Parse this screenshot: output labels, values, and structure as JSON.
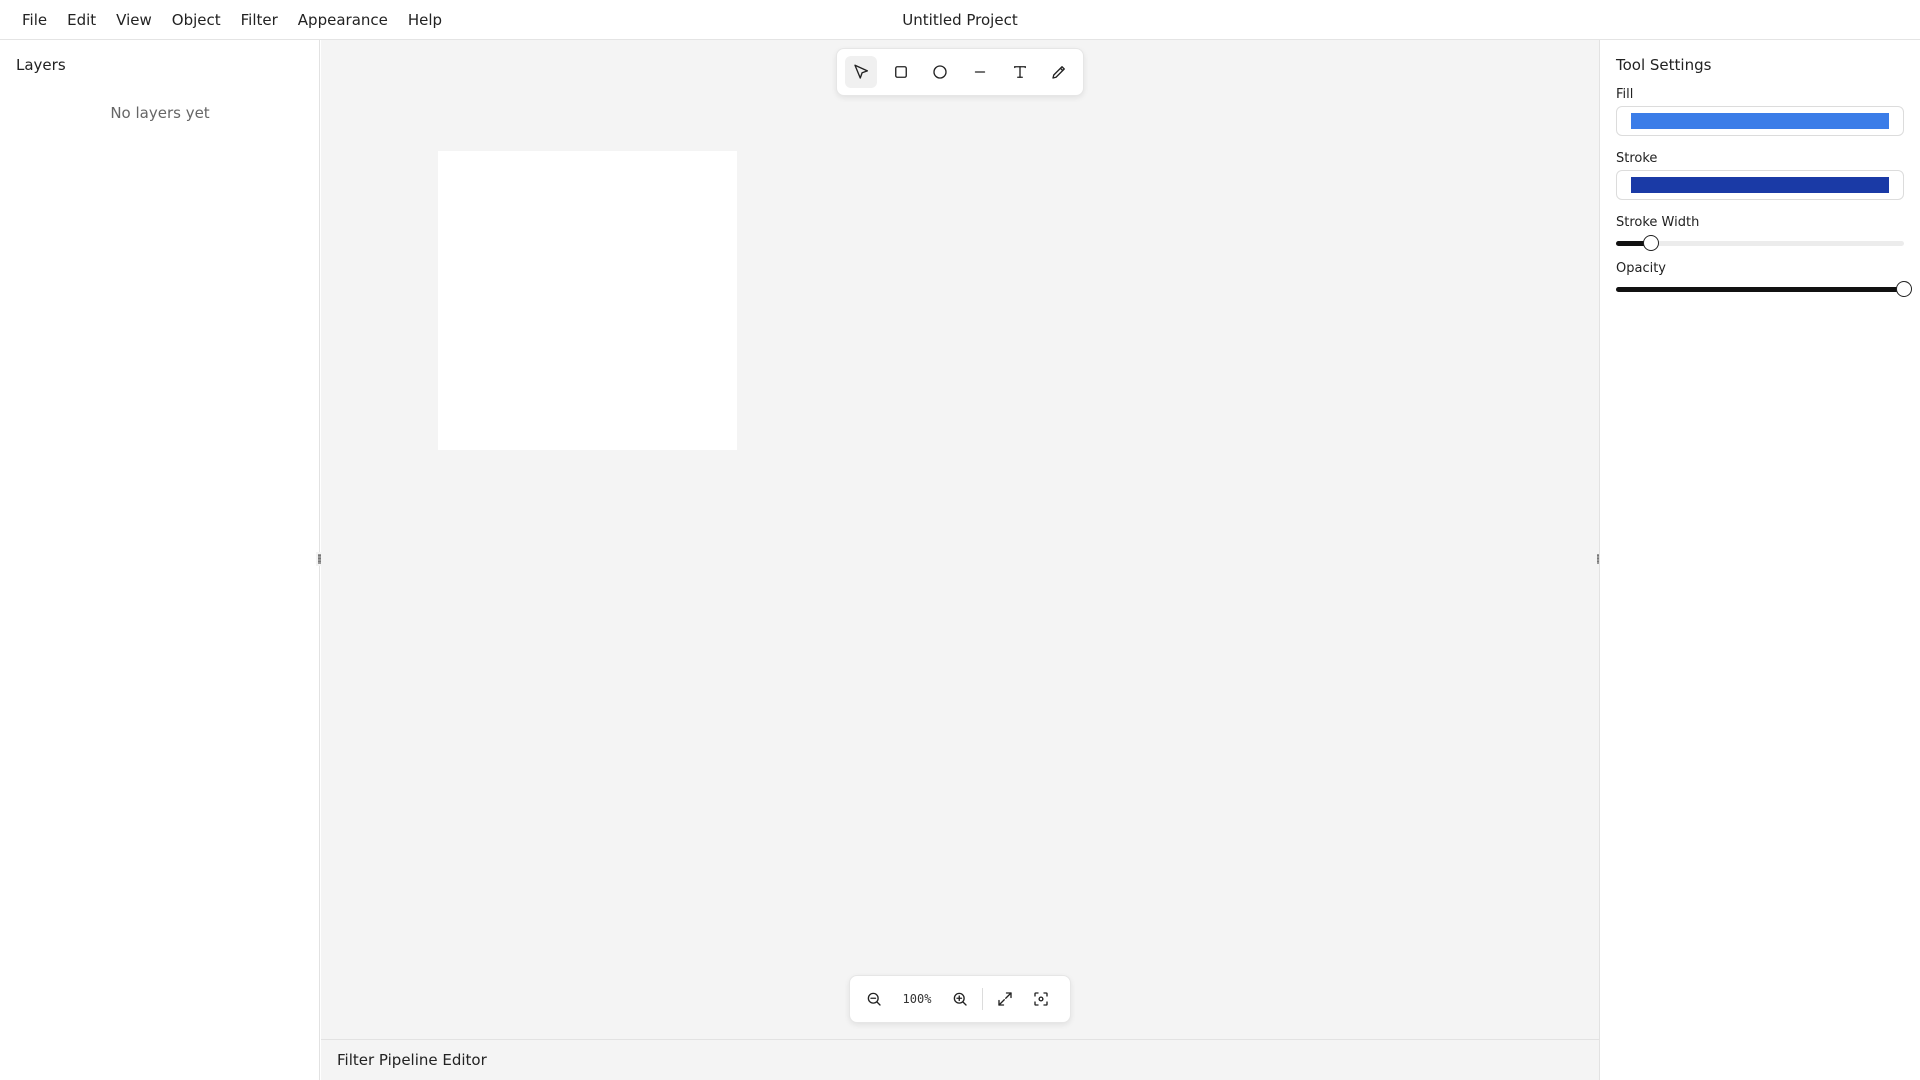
{
  "menubar": {
    "items": [
      "File",
      "Edit",
      "View",
      "Object",
      "Filter",
      "Appearance",
      "Help"
    ],
    "title": "Untitled Project"
  },
  "layers_panel": {
    "title": "Layers",
    "empty_text": "No layers yet"
  },
  "toolbar": {
    "tools": [
      {
        "name": "select-tool",
        "icon": "cursor-arrow-icon",
        "active": true
      },
      {
        "name": "rectangle-tool",
        "icon": "square-icon",
        "active": false
      },
      {
        "name": "ellipse-tool",
        "icon": "circle-icon",
        "active": false
      },
      {
        "name": "line-tool",
        "icon": "line-icon",
        "active": false
      },
      {
        "name": "text-tool",
        "icon": "text-icon",
        "active": false
      },
      {
        "name": "pen-tool",
        "icon": "pencil-icon",
        "active": false
      }
    ]
  },
  "zoom": {
    "level": "100%",
    "buttons": [
      "zoom-out-icon",
      "zoom-in-icon",
      "fit-screen-icon",
      "center-view-icon"
    ]
  },
  "bottom_panel": {
    "title": "Filter Pipeline Editor"
  },
  "tool_settings": {
    "title": "Tool Settings",
    "fill_label": "Fill",
    "fill_color": "#3b7de8",
    "stroke_label": "Stroke",
    "stroke_color": "#1a3aa6",
    "stroke_width_label": "Stroke Width",
    "stroke_width_fraction": 0.12,
    "opacity_label": "Opacity",
    "opacity_fraction": 1.0
  }
}
